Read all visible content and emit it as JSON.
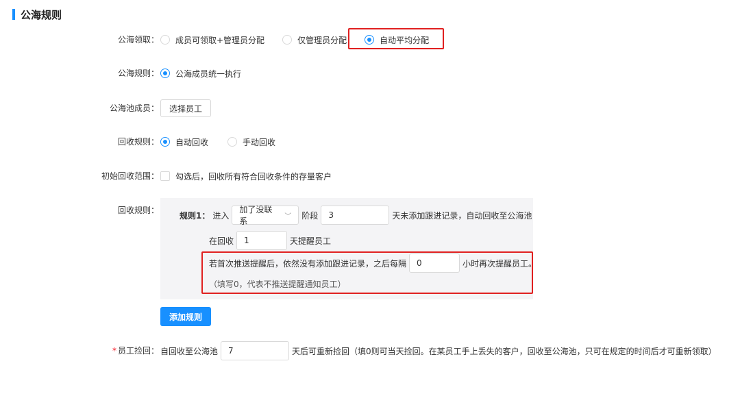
{
  "section": {
    "title": "公海规则"
  },
  "claim": {
    "label": "公海领取：",
    "options": [
      {
        "label": "成员可领取+管理员分配",
        "checked": false
      },
      {
        "label": "仅管理员分配",
        "checked": false
      },
      {
        "label": "自动平均分配",
        "checked": true
      }
    ]
  },
  "rule": {
    "label": "公海规则：",
    "options": [
      {
        "label": "公海成员统一执行",
        "checked": true
      }
    ]
  },
  "members": {
    "label": "公海池成员：",
    "button": "选择员工"
  },
  "recycle_mode": {
    "label": "回收规则：",
    "options": [
      {
        "label": "自动回收",
        "checked": true
      },
      {
        "label": "手动回收",
        "checked": false
      }
    ]
  },
  "initial_scope": {
    "label": "初始回收范围：",
    "checkbox_label": "勾选后，回收所有符合回收条件的存量客户",
    "checked": false
  },
  "recycle_rules": {
    "label": "回收规则：",
    "rule1_prefix": "规则1：",
    "enter_text": "进入",
    "stage_select": "加了没联系",
    "stage_text": "阶段",
    "days_value": "3",
    "days_suffix": "天未添加跟进记录，自动回收至公海池",
    "remind_prefix": "在回收",
    "remind_value": "1",
    "remind_suffix": "天提醒员工",
    "repeat_prefix": "若首次推送提醒后，依然没有添加跟进记录，之后每隔",
    "repeat_value": "0",
    "repeat_suffix": "小时再次提醒员工。",
    "note": "（填写0，代表不推送提醒通知员工）",
    "add_button": "添加规则"
  },
  "pickup": {
    "required_mark": "*",
    "label": "员工捡回：",
    "prefix": "自回收至公海池",
    "value": "7",
    "suffix": "天后可重新捡回（填0则可当天捡回。在某员工手上丢失的客户，回收至公海池，只可在规定的时间后才可重新领取）"
  }
}
